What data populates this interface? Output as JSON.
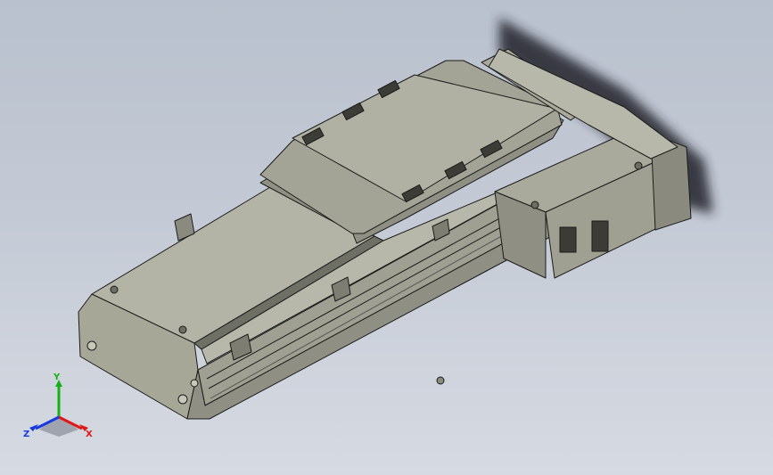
{
  "viewport": {
    "background_top": "#b9c1ce",
    "background_bottom": "#d6dae2"
  },
  "model": {
    "body_color": "#a9aa9b",
    "edge_color": "#1c1c1c",
    "shadow_color": "#20242c"
  },
  "triad": {
    "x_label": "X",
    "y_label": "Y",
    "z_label": "Z",
    "x_color": "#e01818",
    "y_color": "#18b018",
    "z_color": "#1838e0"
  }
}
